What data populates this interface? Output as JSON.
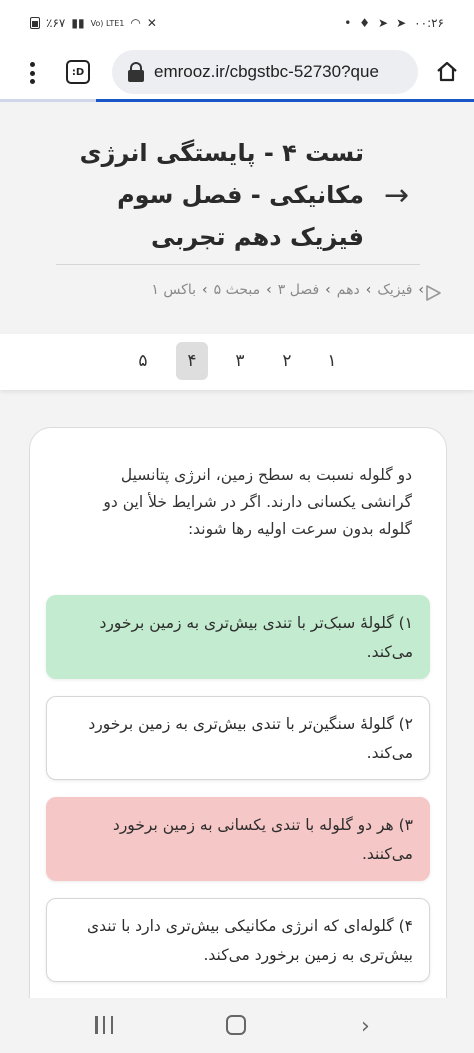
{
  "status_bar": {
    "time": "۰۰:۲۶",
    "battery": "٪۶۷",
    "network": "Vo) LTE1"
  },
  "browser": {
    "url": "emrooz.ir/cbgstbc-52730?que",
    "tab_icon": ":D"
  },
  "page": {
    "title": "تست ۴ - پایستگی انرژی مکانیکی - فصل سوم فیزیک دهم تجربی",
    "breadcrumb": [
      "فیزیک",
      "دهم",
      "فصل ۳",
      "مبحث ۵",
      "باکس ۱"
    ]
  },
  "question_tabs": [
    "۱",
    "۲",
    "۳",
    "۴",
    "۵"
  ],
  "active_tab": "۴",
  "question": {
    "text": "دو گلوله نسبت به سطح زمین، انرژی پتانسیل گرانشی یکسانی دارند. اگر در شرایط خلأ این دو گلوله بدون سرعت اولیه رها شوند:",
    "options": [
      {
        "label": "۱) گلولهٔ سبک‌تر با تندی بیش‌تری به زمین برخورد می‌کند.",
        "state": "correct"
      },
      {
        "label": "۲) گلولهٔ سنگین‌تر با تندی بیش‌تری به زمین برخورد می‌کند.",
        "state": "neutral"
      },
      {
        "label": "۳) هر دو گلوله با تندی یکسانی به زمین برخورد می‌کنند.",
        "state": "wrong"
      },
      {
        "label": "۴) گلوله‌ای که انرژی مکانیکی بیش‌تری دارد با تندی بیش‌تری به زمین برخورد می‌کند.",
        "state": "neutral"
      }
    ]
  },
  "colors": {
    "correct": "#c3ebcf",
    "wrong": "#f6c7c7",
    "accent": "#1a56c8"
  }
}
